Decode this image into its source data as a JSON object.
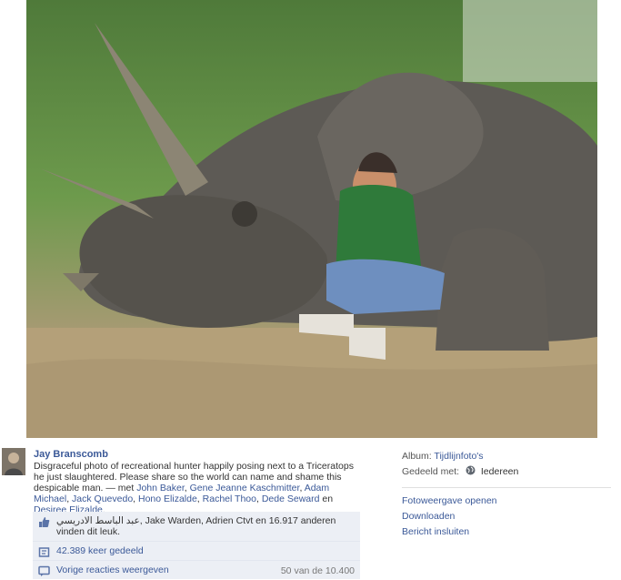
{
  "photo": {
    "alt_icon": "photo-triceratops"
  },
  "post": {
    "author": "Jay Branscomb",
    "caption_text": "Disgraceful photo of recreational hunter happily posing next to a Triceratops he just slaughtered. Please share so the world can name and shame this despicable man. — met ",
    "tagged": [
      "John Baker",
      "Gene Jeanne Kaschmitter",
      "Adam Michael",
      "Jack Quevedo",
      "Hono Elizalde",
      "Rachel Thoo",
      "Dede Seward",
      "Desiree Elizalde"
    ],
    "tag_sep1": ", ",
    "tag_sep_last": " en ",
    "tag_end": "."
  },
  "side": {
    "album_label": "Album:",
    "album_value": "Tijdlijnfoto's",
    "shared_label": "Gedeeld met:",
    "shared_value": "Iedereen",
    "links": [
      "Fotoweergave openen",
      "Downloaden",
      "Bericht insluiten"
    ]
  },
  "actions": {
    "likes_text": "عبد الباسط الادريسي, Jake Warden, Adrien Ctvt en 16.917 anderen vinden dit leuk.",
    "shares_text": "42.389 keer gedeeld",
    "prev_comments": "Vorige reacties weergeven",
    "comment_count": "50 van de 10.400"
  },
  "colors": {
    "link": "#3b5998",
    "panel": "#eceff5"
  }
}
